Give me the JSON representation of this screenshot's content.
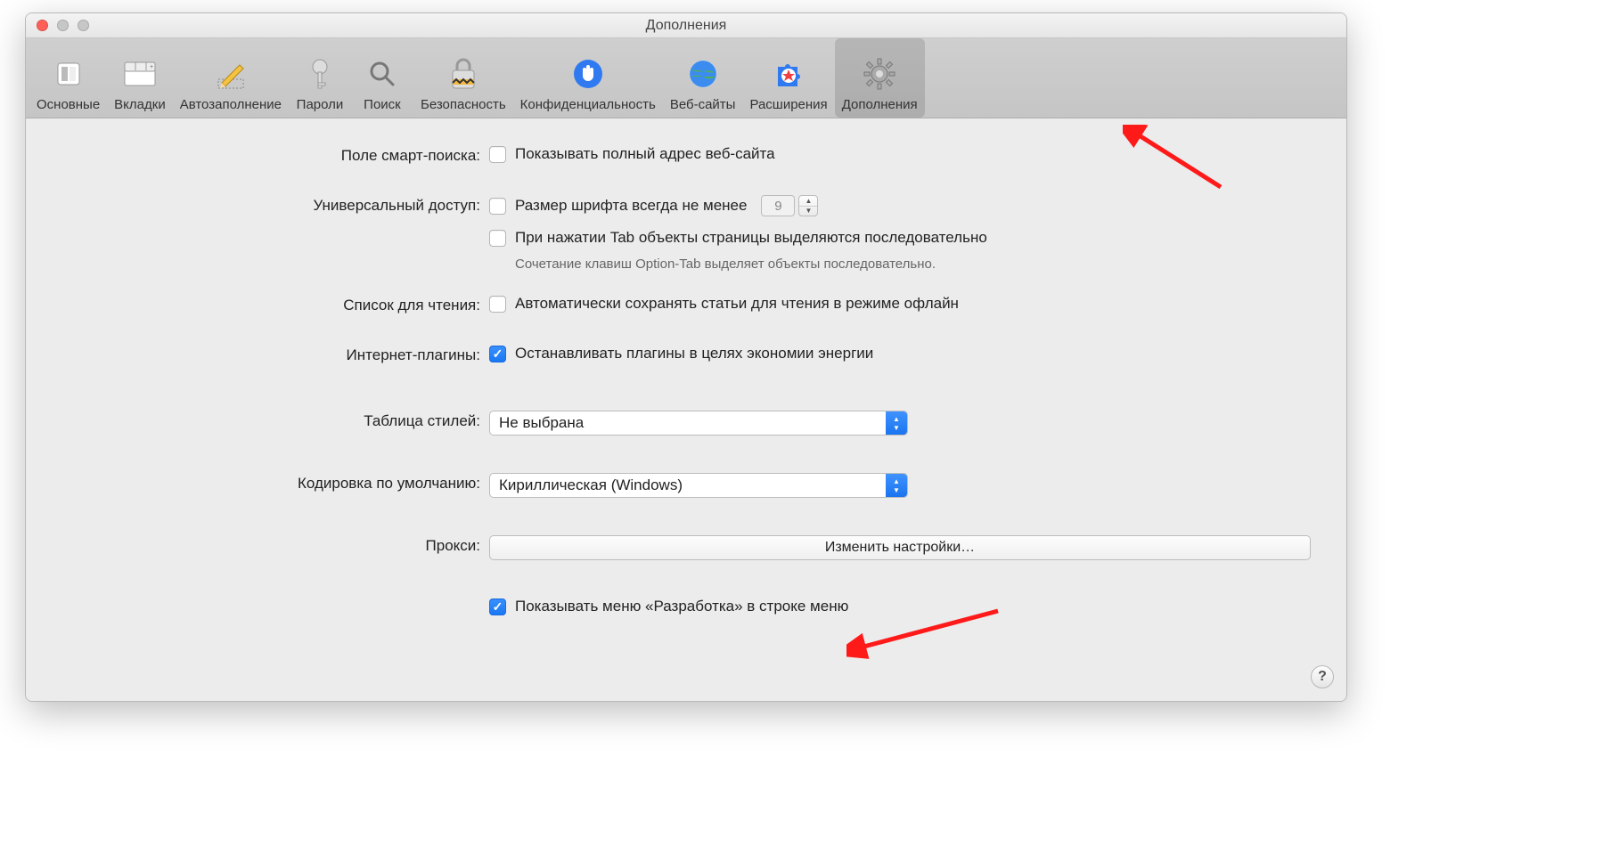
{
  "window": {
    "title": "Дополнения"
  },
  "toolbar": {
    "items": [
      {
        "label": "Основные"
      },
      {
        "label": "Вкладки"
      },
      {
        "label": "Автозаполнение"
      },
      {
        "label": "Пароли"
      },
      {
        "label": "Поиск"
      },
      {
        "label": "Безопасность"
      },
      {
        "label": "Конфиденциальность"
      },
      {
        "label": "Веб-сайты"
      },
      {
        "label": "Расширения"
      },
      {
        "label": "Дополнения"
      }
    ],
    "selected_index": 9
  },
  "sections": {
    "smart_search": {
      "label": "Поле смарт-поиска:",
      "show_full_url": {
        "checked": false,
        "label": "Показывать полный адрес веб-сайта"
      }
    },
    "accessibility": {
      "label": "Универсальный доступ:",
      "min_font": {
        "checked": false,
        "label": "Размер шрифта всегда не менее",
        "value": "9"
      },
      "tab_highlight": {
        "checked": false,
        "label": "При нажатии Tab объекты страницы выделяются последовательно"
      },
      "help": "Сочетание клавиш Option-Tab выделяет объекты последовательно."
    },
    "reading_list": {
      "label": "Список для чтения:",
      "save_offline": {
        "checked": false,
        "label": "Автоматически сохранять статьи для чтения в режиме офлайн"
      }
    },
    "plugins": {
      "label": "Интернет-плагины:",
      "stop_to_save": {
        "checked": true,
        "label": "Останавливать плагины в целях экономии энергии"
      }
    },
    "stylesheet": {
      "label": "Таблица стилей:",
      "selected": "Не выбрана"
    },
    "encoding": {
      "label": "Кодировка по умолчанию:",
      "selected": "Кириллическая (Windows)"
    },
    "proxies": {
      "label": "Прокси:",
      "button": "Изменить настройки…"
    },
    "develop_menu": {
      "checked": true,
      "label": "Показывать меню «Разработка» в строке меню"
    }
  },
  "help_button": "?"
}
